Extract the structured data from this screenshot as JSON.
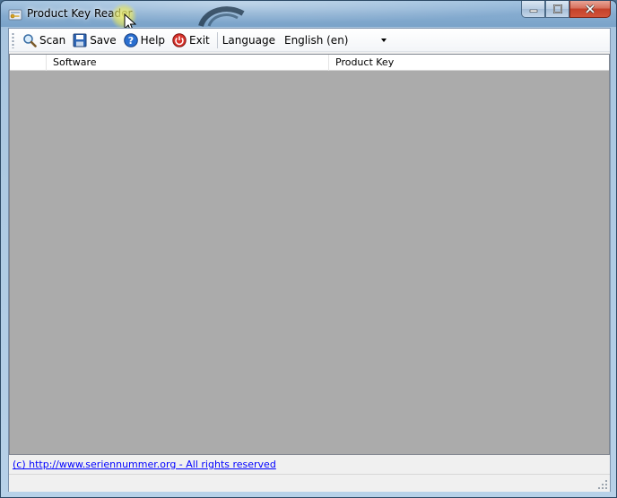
{
  "window": {
    "title": "Product Key Reader",
    "accent_color": "#7aa3c9",
    "close_color": "#c4412a"
  },
  "toolbar": {
    "scan_label": "Scan",
    "save_label": "Save",
    "help_label": "Help",
    "exit_label": "Exit",
    "language_label": "Language",
    "language_value": "English (en)"
  },
  "icons": {
    "scan": "magnifier-icon",
    "save": "floppy-disk-icon",
    "help": "help-icon",
    "exit": "power-icon"
  },
  "table": {
    "columns": [
      "",
      "Software",
      "Product Key"
    ],
    "rows": [],
    "background_color": "#ababab"
  },
  "footer": {
    "link_text": "(c) http://www.seriennummer.org - All rights reserved",
    "link_color": "#0000ff"
  }
}
